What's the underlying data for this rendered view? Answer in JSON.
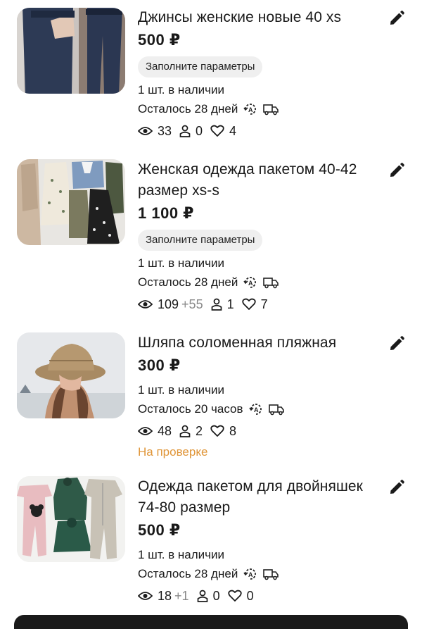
{
  "listings": [
    {
      "title": "Джинсы женские новые 40 xs",
      "price": "500 ₽",
      "chip": "Заполните параметры",
      "stock": "1 шт. в наличии",
      "remaining": "Осталось 28 дней",
      "views": "33",
      "views_delta": "",
      "contacts": "0",
      "favorites": "4",
      "status": ""
    },
    {
      "title": "Женская одежда пакетом 40-42 размер xs-s",
      "price": "1 100 ₽",
      "chip": "Заполните параметры",
      "stock": "1 шт. в наличии",
      "remaining": "Осталось 28 дней",
      "views": "109",
      "views_delta": "+55",
      "contacts": "1",
      "favorites": "7",
      "status": ""
    },
    {
      "title": "Шляпа соломенная пляжная",
      "price": "300 ₽",
      "chip": "",
      "stock": "1 шт. в наличии",
      "remaining": "Осталось 20 часов",
      "views": "48",
      "views_delta": "",
      "contacts": "2",
      "favorites": "8",
      "status": "На проверке"
    },
    {
      "title": "Одежда пакетом для двойняшек 74-80 размер",
      "price": "500 ₽",
      "chip": "",
      "stock": "1 шт. в наличии",
      "remaining": "Осталось 28 дней",
      "views": "18",
      "views_delta": "+1",
      "contacts": "0",
      "favorites": "0",
      "status": ""
    }
  ],
  "icons": {
    "edit": "pencil-icon",
    "autoboost": "auto-renew-icon",
    "delivery": "truck-icon",
    "views": "eye-icon",
    "contacts": "person-icon",
    "favorites": "heart-icon"
  },
  "colors": {
    "status_review": "#e0963a",
    "delta": "#8a8a8a",
    "chip_bg": "#efefef"
  }
}
